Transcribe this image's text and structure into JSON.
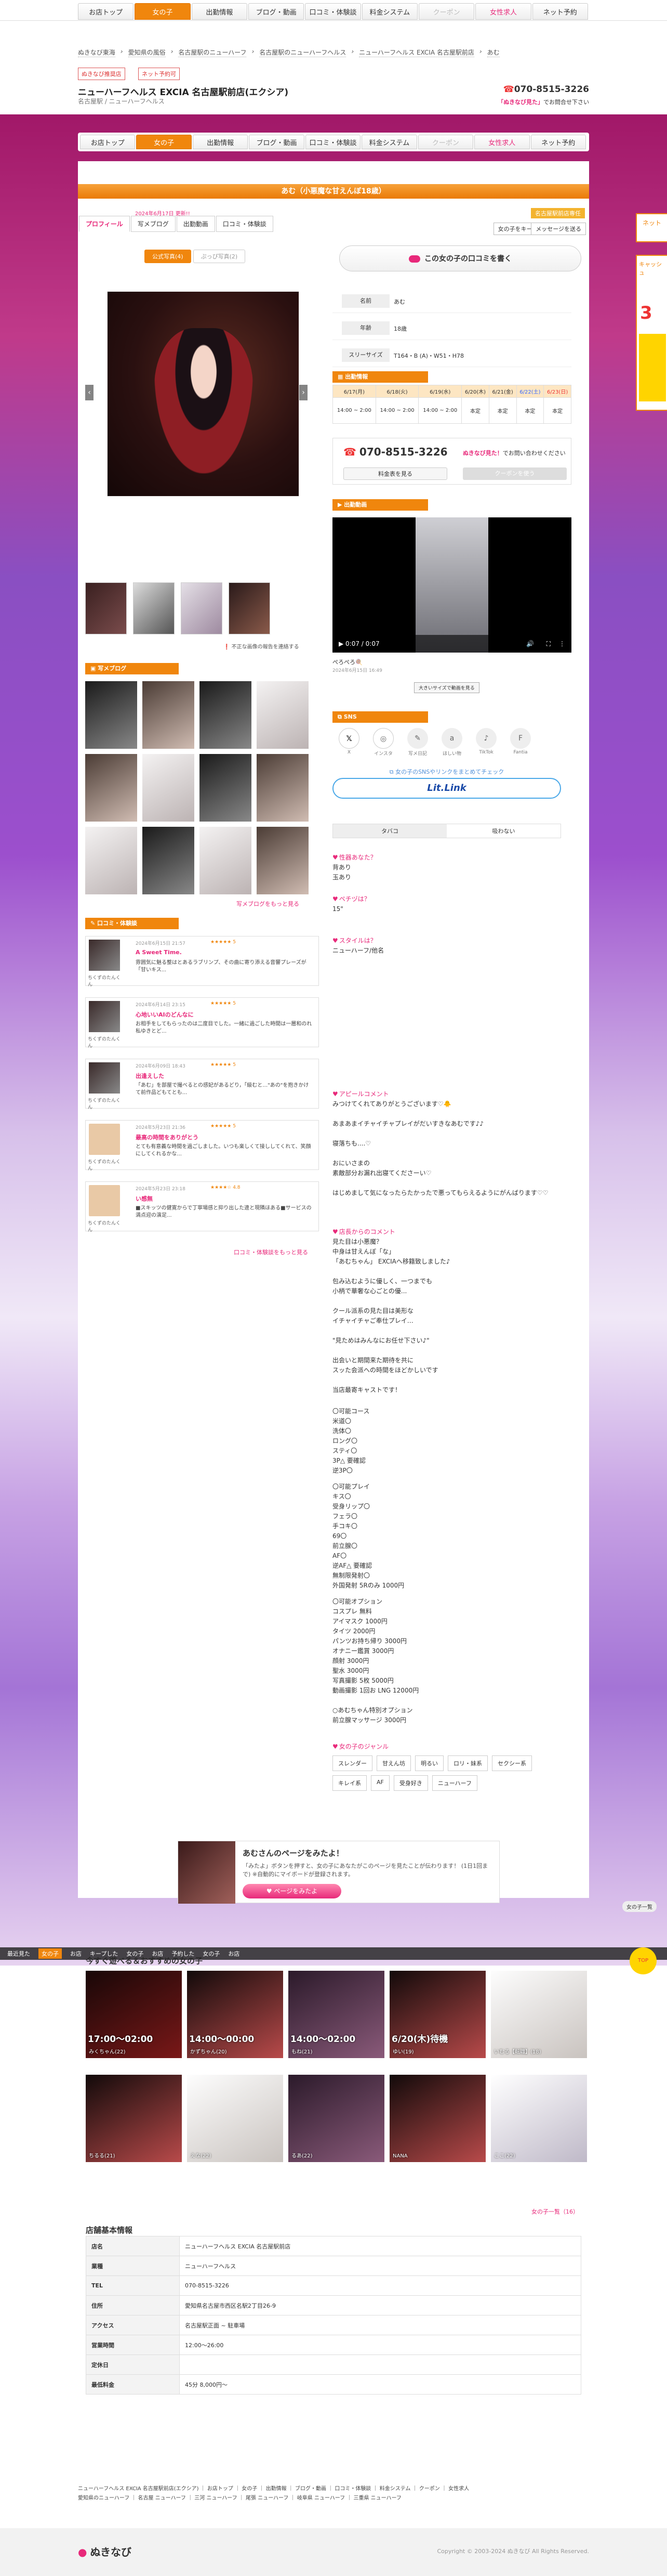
{
  "nav": {
    "items": [
      {
        "label": "お店トップ",
        "state": ""
      },
      {
        "label": "女の子",
        "state": "active"
      },
      {
        "label": "出勤情報",
        "state": ""
      },
      {
        "label": "ブログ・動画",
        "state": ""
      },
      {
        "label": "口コミ・体験談",
        "state": ""
      },
      {
        "label": "料金システム",
        "state": ""
      },
      {
        "label": "クーポン",
        "state": "dim"
      },
      {
        "label": "女性求人",
        "state": "pink"
      },
      {
        "label": "ネット予約",
        "state": ""
      }
    ]
  },
  "breadcrumb": [
    "ぬきなび東海",
    "愛知県の風俗",
    "名古屋駅のニューハーフ",
    "名古屋駅のニューハーフヘルス",
    "ニューハーフヘルス EXCIA 名古屋駅前店",
    "あむ"
  ],
  "tags": {
    "left": "ぬきなび推奨店",
    "left2": "ネット予約可",
    "right": "ぬきなび東海店舗予約"
  },
  "shop": {
    "name": "ニューハーフヘルス EXCIA 名古屋駅前店(エクシア)",
    "sub": "名古屋駅 / ニューハーフヘルス",
    "tel": "070-8515-3226",
    "note_em": "「ぬきなび見た」",
    "note": "でお問合せ下さい"
  },
  "girl": {
    "title": "あむ（小悪魔な甘えんぼ18歳）",
    "updated": "2024年6月17日 更新!!",
    "tabs": [
      "プロフィール",
      "写メブログ",
      "出勤動画",
      "口コミ・体験談"
    ],
    "badge": "名古屋駅前店専任",
    "btn_keep": "女の子をキープ",
    "btn_msg": "メッセージを送る",
    "subtabs": [
      "公式写真(4)",
      "ぷっぴ写真(2)"
    ],
    "arrow_prev": "‹",
    "arrow_next": "›",
    "photo_note": "不正な画像の報告を連絡する",
    "kuchikomi_btn": "この女の子の口コミを書く",
    "profile": [
      {
        "key": "名前",
        "value": "あむ"
      },
      {
        "key": "年齢",
        "value": "18歳"
      },
      {
        "key": "スリーサイズ",
        "value": "T164・B (A)・W51・H78"
      }
    ]
  },
  "schedule": {
    "title": "出勤情報",
    "days": [
      {
        "day": "6/17(月)",
        "time": "14:00 ~ 2:00",
        "cls": ""
      },
      {
        "day": "6/18(火)",
        "time": "14:00 ~ 2:00",
        "cls": ""
      },
      {
        "day": "6/19(水)",
        "time": "14:00 ~ 2:00",
        "cls": ""
      },
      {
        "day": "6/20(木)",
        "time": "本定",
        "cls": ""
      },
      {
        "day": "6/21(金)",
        "time": "本定",
        "cls": ""
      },
      {
        "day": "6/22(土)",
        "time": "本定",
        "cls": "sat"
      },
      {
        "day": "6/23(日)",
        "time": "本定",
        "cls": "sun"
      }
    ]
  },
  "contact": {
    "tel": "070-8515-3226",
    "note_em": "ぬきなび見た！",
    "note": "でお問い合わせください",
    "btn_fee": "料金表を見る",
    "btn_coupon": "クーポンを使う"
  },
  "video": {
    "section": "出勤動画",
    "time": "0:07 / 0:07",
    "caption": "ぺろぺろ🍭",
    "date": "2024年6月15日 16:49",
    "btn": "大きいサイズで動画を見る"
  },
  "sns": {
    "section": "SNS",
    "items": [
      {
        "label": "X",
        "glyph": "𝕏",
        "cls": "x"
      },
      {
        "label": "インスタ",
        "glyph": "◎",
        "cls": "ig"
      },
      {
        "label": "写メ日記",
        "glyph": "✎",
        "cls": ""
      },
      {
        "label": "ほしい物",
        "glyph": "a",
        "cls": ""
      },
      {
        "label": "TikTok",
        "glyph": "♪",
        "cls": ""
      },
      {
        "label": "Fantia",
        "glyph": "F",
        "cls": ""
      }
    ],
    "note": "女の子のSNSやリンクをまとめてチェック",
    "litlink": "Lit.Link"
  },
  "smoke": {
    "k": "タバコ",
    "v": "吸わない"
  },
  "qa": [
    {
      "q": "性器あなた？",
      "a": "背あり\n玉あり"
    },
    {
      "q": "ペチヅは？",
      "a": "15\""
    },
    {
      "q": "スタイルは？",
      "a": "ニューハーフ/他名"
    }
  ],
  "appeal": {
    "title": "アピールコメント",
    "body": "みつけてくれてありがとうございます♡🐥\n\nあまあまイチャイチャプレイがだいすきなあむです♪♪\n\n寝落ちも....♡\n\nおにいさまの\n素敵部分お漏れ出寝てくださーい♡\n\nはじめまして気になったらたかったで悪ってもらえるようにがんばります♡♡"
  },
  "shopcomment": {
    "title": "店長からのコメント",
    "body": "見た目は小悪魔？\n中身は甘えんぼ「な」\n「あむちゃん」 EXCIAへ移籍致しました♪\n\n包み込むように優しく、一つまでも\n小柄で華奢な心ごとの優...\n\nクール派系の見た目は美形な\nイチャイチャご奉仕プレイ…\n\n\"見ためはみんなにお任せ下さい♪\"\n\n出会いと期間来た期待を共に\nスッた会派への時間をほどかしいです\n\n当店最寄キャストです！",
    "course_title": "〇可能コース",
    "course": "米道〇\n洗体〇\nロング〇\nスティ〇\n3P△ 要確認\n逆3P〇",
    "play_title": "〇可能プレイ",
    "play": "キス〇\n受身リップ〇\nフェラ〇\n手コキ〇\n69〇\n前立腺〇\nAF〇\n逆AF△ 要確認\n無制限発射〇\n外国発射 5Rのみ 1000円",
    "opt_title": "〇可能オプション",
    "opt": "コスプレ 無料\nアイマスク 1000円\nタイツ 2000円\nパンツお持ち帰り 3000円\nオナニー鑑賞 3000円\n顔射 3000円\n聖水 3000円\n写真撮影 5枚 5000円\n動画撮影 1回お LNG 12000円\n\n○あむちゃん特別オプション\n前立腺マッサージ 3000円"
  },
  "genre": {
    "title": "女の子のジャンル",
    "items": [
      "スレンダー",
      "甘えん坊",
      "明るい",
      "ロリ・妹系",
      "セクシー系",
      "キレイ系",
      "AF",
      "受身好き",
      "ニューハーフ"
    ]
  },
  "blog": {
    "section": "写メブログ",
    "more": "写メブログをもっと見る"
  },
  "reviews": {
    "section": "口コミ・体験談",
    "more": "口コミ・体験談をもっと見る",
    "items": [
      {
        "user": "ちくずのたんくん",
        "date": "2024年6月15日 21:57",
        "stars": "★★★★★ 5",
        "title": "A Sweet Time.",
        "body": "雰囲気に魅る整はとあるラブリンプ、その曲に寄り添える音響プレーズが「甘いキス...",
        "blank": false
      },
      {
        "user": "ちくずのたんくん",
        "date": "2024年6月14日 23:15",
        "stars": "★★★★★ 5",
        "title": "心地いいAIのどんなに",
        "body": "お相手をしてもらったのは二度目でした。一緒に過ごした時間は一層和のれ私ゆきとど...",
        "blank": false
      },
      {
        "user": "ちくずのたんくん",
        "date": "2024年6月09日 18:43",
        "stars": "★★★★★ 5",
        "title": "出逢えした",
        "body": "「あむ」を部屋で撮べるとの感妃があるどり，「級むと…\"あの\"を抱きかけて前作品どもてとも...",
        "blank": false
      },
      {
        "user": "ちくずのたんくん",
        "date": "2024年5月23日 21:36",
        "stars": "★★★★★ 5",
        "title": "最高の時間をありがとう",
        "body": "とても有意義な時間を過ごしました。いつも楽しくて接ししてくれて、笑顔にしてくれるかな...",
        "blank": true
      },
      {
        "user": "ちくずのたんくん",
        "date": "2024年5月23日 23:18",
        "stars": "★★★★☆ 4.8",
        "title": "い感無",
        "body": "■スキッツの健寛からで丁寧場感と抑り出した違と現隣ほある■サービスの満点迎の演足...",
        "blank": true
      }
    ]
  },
  "pagebanner": {
    "title": "あむさんのページをみたよ！",
    "desc": "「みたよ」ボタンを押すと、女の子にあなたがこのページを見たことが伝わります！ (1日1回まで) ※自動的にマイボードが登録されます。",
    "btn": "ページをみたよ"
  },
  "recs": {
    "title": "今すぐ遊べる＆おすすめの女の子",
    "row1": [
      {
        "cap": "17:00～02:00",
        "nm": "みくちゃん(22)",
        "cls": ""
      },
      {
        "cap": "14:00～00:00",
        "nm": "かずちゃん(20)",
        "cls": "b"
      },
      {
        "cap": "14:00～02:00",
        "nm": "もね(21)",
        "cls": "c"
      },
      {
        "cap": "6/20(木)待機",
        "nm": "ゆい(19)",
        "cls": "b"
      },
      {
        "cap": "",
        "nm": "いむる【転職】(18)",
        "cls": "a"
      }
    ],
    "row2": [
      {
        "cap": "",
        "nm": "ちるる(21)",
        "cls": "b"
      },
      {
        "cap": "",
        "nm": "えな(22)",
        "cls": "a"
      },
      {
        "cap": "",
        "nm": "るあ(22)",
        "cls": "c"
      },
      {
        "cap": "",
        "nm": "NANA",
        "cls": "b"
      },
      {
        "cap": "",
        "nm": "ここ(22)",
        "cls": "d"
      }
    ],
    "more": "女の子一覧（16）"
  },
  "bottombar": [
    "最近見た",
    "女の子",
    "お店",
    "キープした",
    "女の子",
    "お店",
    "予約した",
    "女の子",
    "お店"
  ],
  "info": {
    "title": "店舗基本情報",
    "rows": [
      {
        "k": "店名",
        "v": "ニューハーフヘルス EXCIA 名古屋駅前店"
      },
      {
        "k": "業種",
        "v": "ニューハーフヘルス"
      },
      {
        "k": "TEL",
        "v": "070-8515-3226"
      },
      {
        "k": "住所",
        "v": "愛知県名古屋市西区名駅2丁目26-9"
      },
      {
        "k": "アクセス",
        "v": "名古屋駅正面 ~ 駐車場"
      },
      {
        "k": "営業時間",
        "v": "12:00～26:00"
      },
      {
        "k": "定休日",
        "v": ""
      },
      {
        "k": "最低料金",
        "v": "45分 8,000円～"
      }
    ]
  },
  "footer": {
    "links": "ニューハーフヘルス EXCIA 名古屋駅前店(エクシア) ｜ お店トップ ｜ 女の子 ｜ 出勤情報 ｜ ブログ・動画 ｜ 口コミ・体験談 ｜ 料金システム ｜ クーポン ｜ 女性求人",
    "links2": "愛知県のニューハーフ ｜ 名古屋 ニューハーフ ｜ 三河 ニューハーフ ｜ 尾張 ニューハーフ ｜ 岐阜県 ニューハーフ ｜ 三重県 ニューハーフ",
    "logo": "ぬきなび",
    "copy": "Copyright © 2003-2024 ぬきなび All Rights Reserved."
  },
  "side": {
    "tab1": "ネット",
    "tab2": "キャッシュ",
    "big": "3",
    "floatlink": "女の子一覧",
    "floatbtn": "TOP"
  }
}
